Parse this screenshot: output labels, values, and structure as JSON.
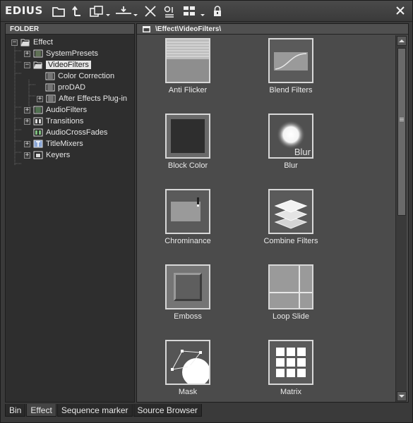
{
  "app": {
    "title": "EDIUS",
    "close_icon": "close-icon"
  },
  "toolbar": {
    "buttons": [
      {
        "name": "folder-view-icon"
      },
      {
        "name": "up-folder-icon"
      },
      {
        "name": "copy-dropdown-icon"
      },
      {
        "name": "timeline-insert-icon"
      },
      {
        "name": "delete-icon"
      },
      {
        "name": "properties-icon"
      },
      {
        "name": "view-mode-icon"
      },
      {
        "name": "lock-icon"
      }
    ]
  },
  "folder_pane": {
    "header": "FOLDER",
    "tree": [
      {
        "label": "Effect",
        "level": 0,
        "expander": "−",
        "icon": "folder-open-icon"
      },
      {
        "label": "SystemPresets",
        "level": 1,
        "expander": "+",
        "icon": "preset-icon"
      },
      {
        "label": "VideoFilters",
        "level": 1,
        "expander": "−",
        "icon": "folder-open-icon",
        "selected": true
      },
      {
        "label": "Color Correction",
        "level": 2,
        "expander": "",
        "icon": "filter-icon"
      },
      {
        "label": "proDAD",
        "level": 2,
        "expander": "",
        "icon": "filter-icon"
      },
      {
        "label": "After Effects Plug-in",
        "level": 2,
        "expander": "+",
        "icon": "filter-icon"
      },
      {
        "label": "AudioFilters",
        "level": 1,
        "expander": "+",
        "icon": "audio-filter-icon"
      },
      {
        "label": "Transitions",
        "level": 1,
        "expander": "+",
        "icon": "transition-icon"
      },
      {
        "label": "AudioCrossFades",
        "level": 1,
        "expander": "",
        "icon": "audio-crossfade-icon"
      },
      {
        "label": "TitleMixers",
        "level": 1,
        "expander": "+",
        "icon": "title-mixer-icon"
      },
      {
        "label": "Keyers",
        "level": 1,
        "expander": "+",
        "icon": "keyer-icon"
      }
    ]
  },
  "content_pane": {
    "path": "\\Effect\\VideoFilters\\",
    "items": [
      {
        "label": "Anti Flicker",
        "thumb": "anti-flicker"
      },
      {
        "label": "Blend Filters",
        "thumb": "blend-filters"
      },
      {
        "label": "Block Color",
        "thumb": "block-color"
      },
      {
        "label": "Blur",
        "thumb": "blur",
        "thumb_text": "Blur"
      },
      {
        "label": "Chrominance",
        "thumb": "chrominance"
      },
      {
        "label": "Combine Filters",
        "thumb": "combine-filters"
      },
      {
        "label": "Emboss",
        "thumb": "emboss"
      },
      {
        "label": "Loop Slide",
        "thumb": "loop-slide"
      },
      {
        "label": "Mask",
        "thumb": "mask"
      },
      {
        "label": "Matrix",
        "thumb": "matrix"
      }
    ]
  },
  "tabs": [
    {
      "label": "Bin",
      "active": false
    },
    {
      "label": "Effect",
      "active": true
    },
    {
      "label": "Sequence marker",
      "active": false
    },
    {
      "label": "Source Browser",
      "active": false
    }
  ]
}
